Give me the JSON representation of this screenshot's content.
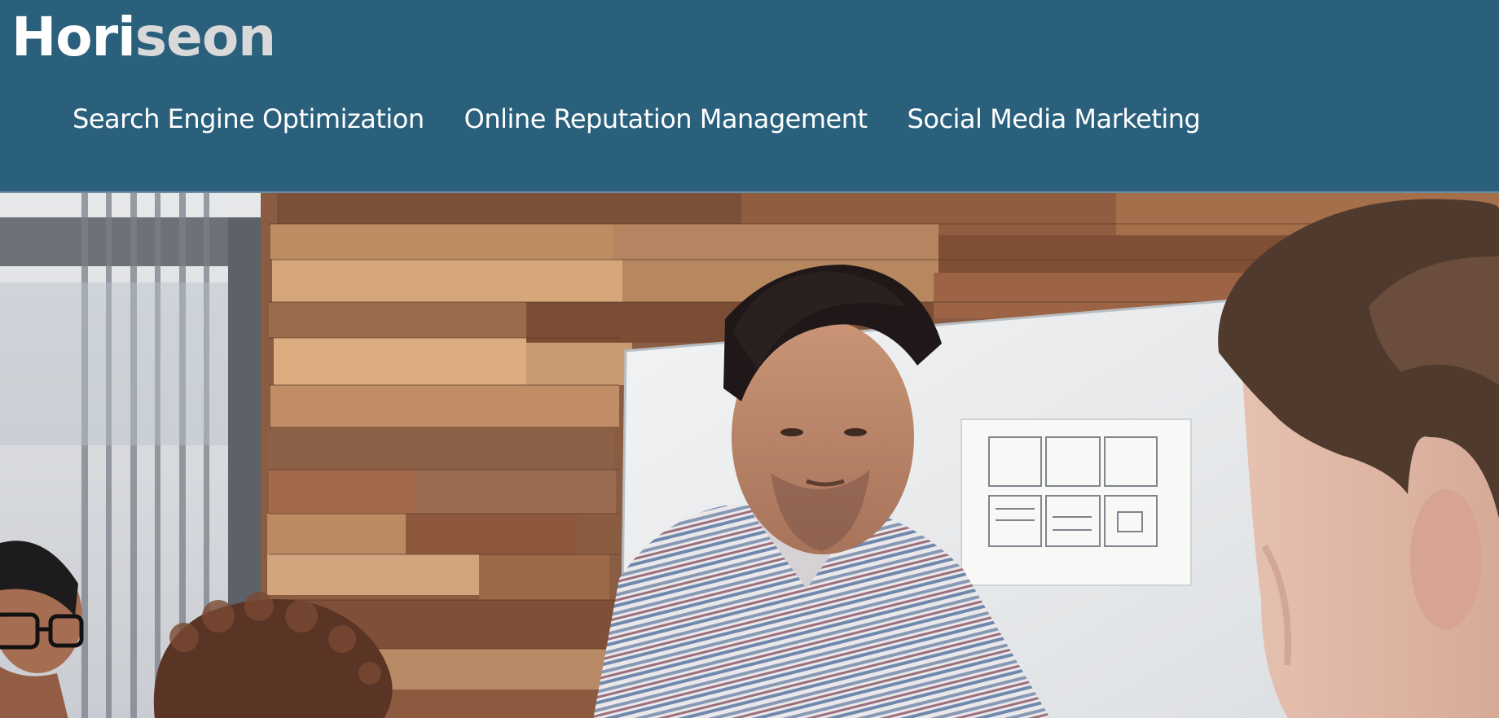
{
  "header": {
    "logo": {
      "part1": "Hori",
      "part2": "seon"
    },
    "nav": [
      {
        "label": "Search Engine Optimization"
      },
      {
        "label": "Online Reputation Management"
      },
      {
        "label": "Social Media Marketing"
      }
    ]
  },
  "colors": {
    "header_bg": "#2a607c",
    "logo_primary": "#ffffff",
    "logo_accent": "#d9d9d9",
    "nav_text": "#ffffff"
  },
  "hero": {
    "image": "team-meeting-photo"
  }
}
